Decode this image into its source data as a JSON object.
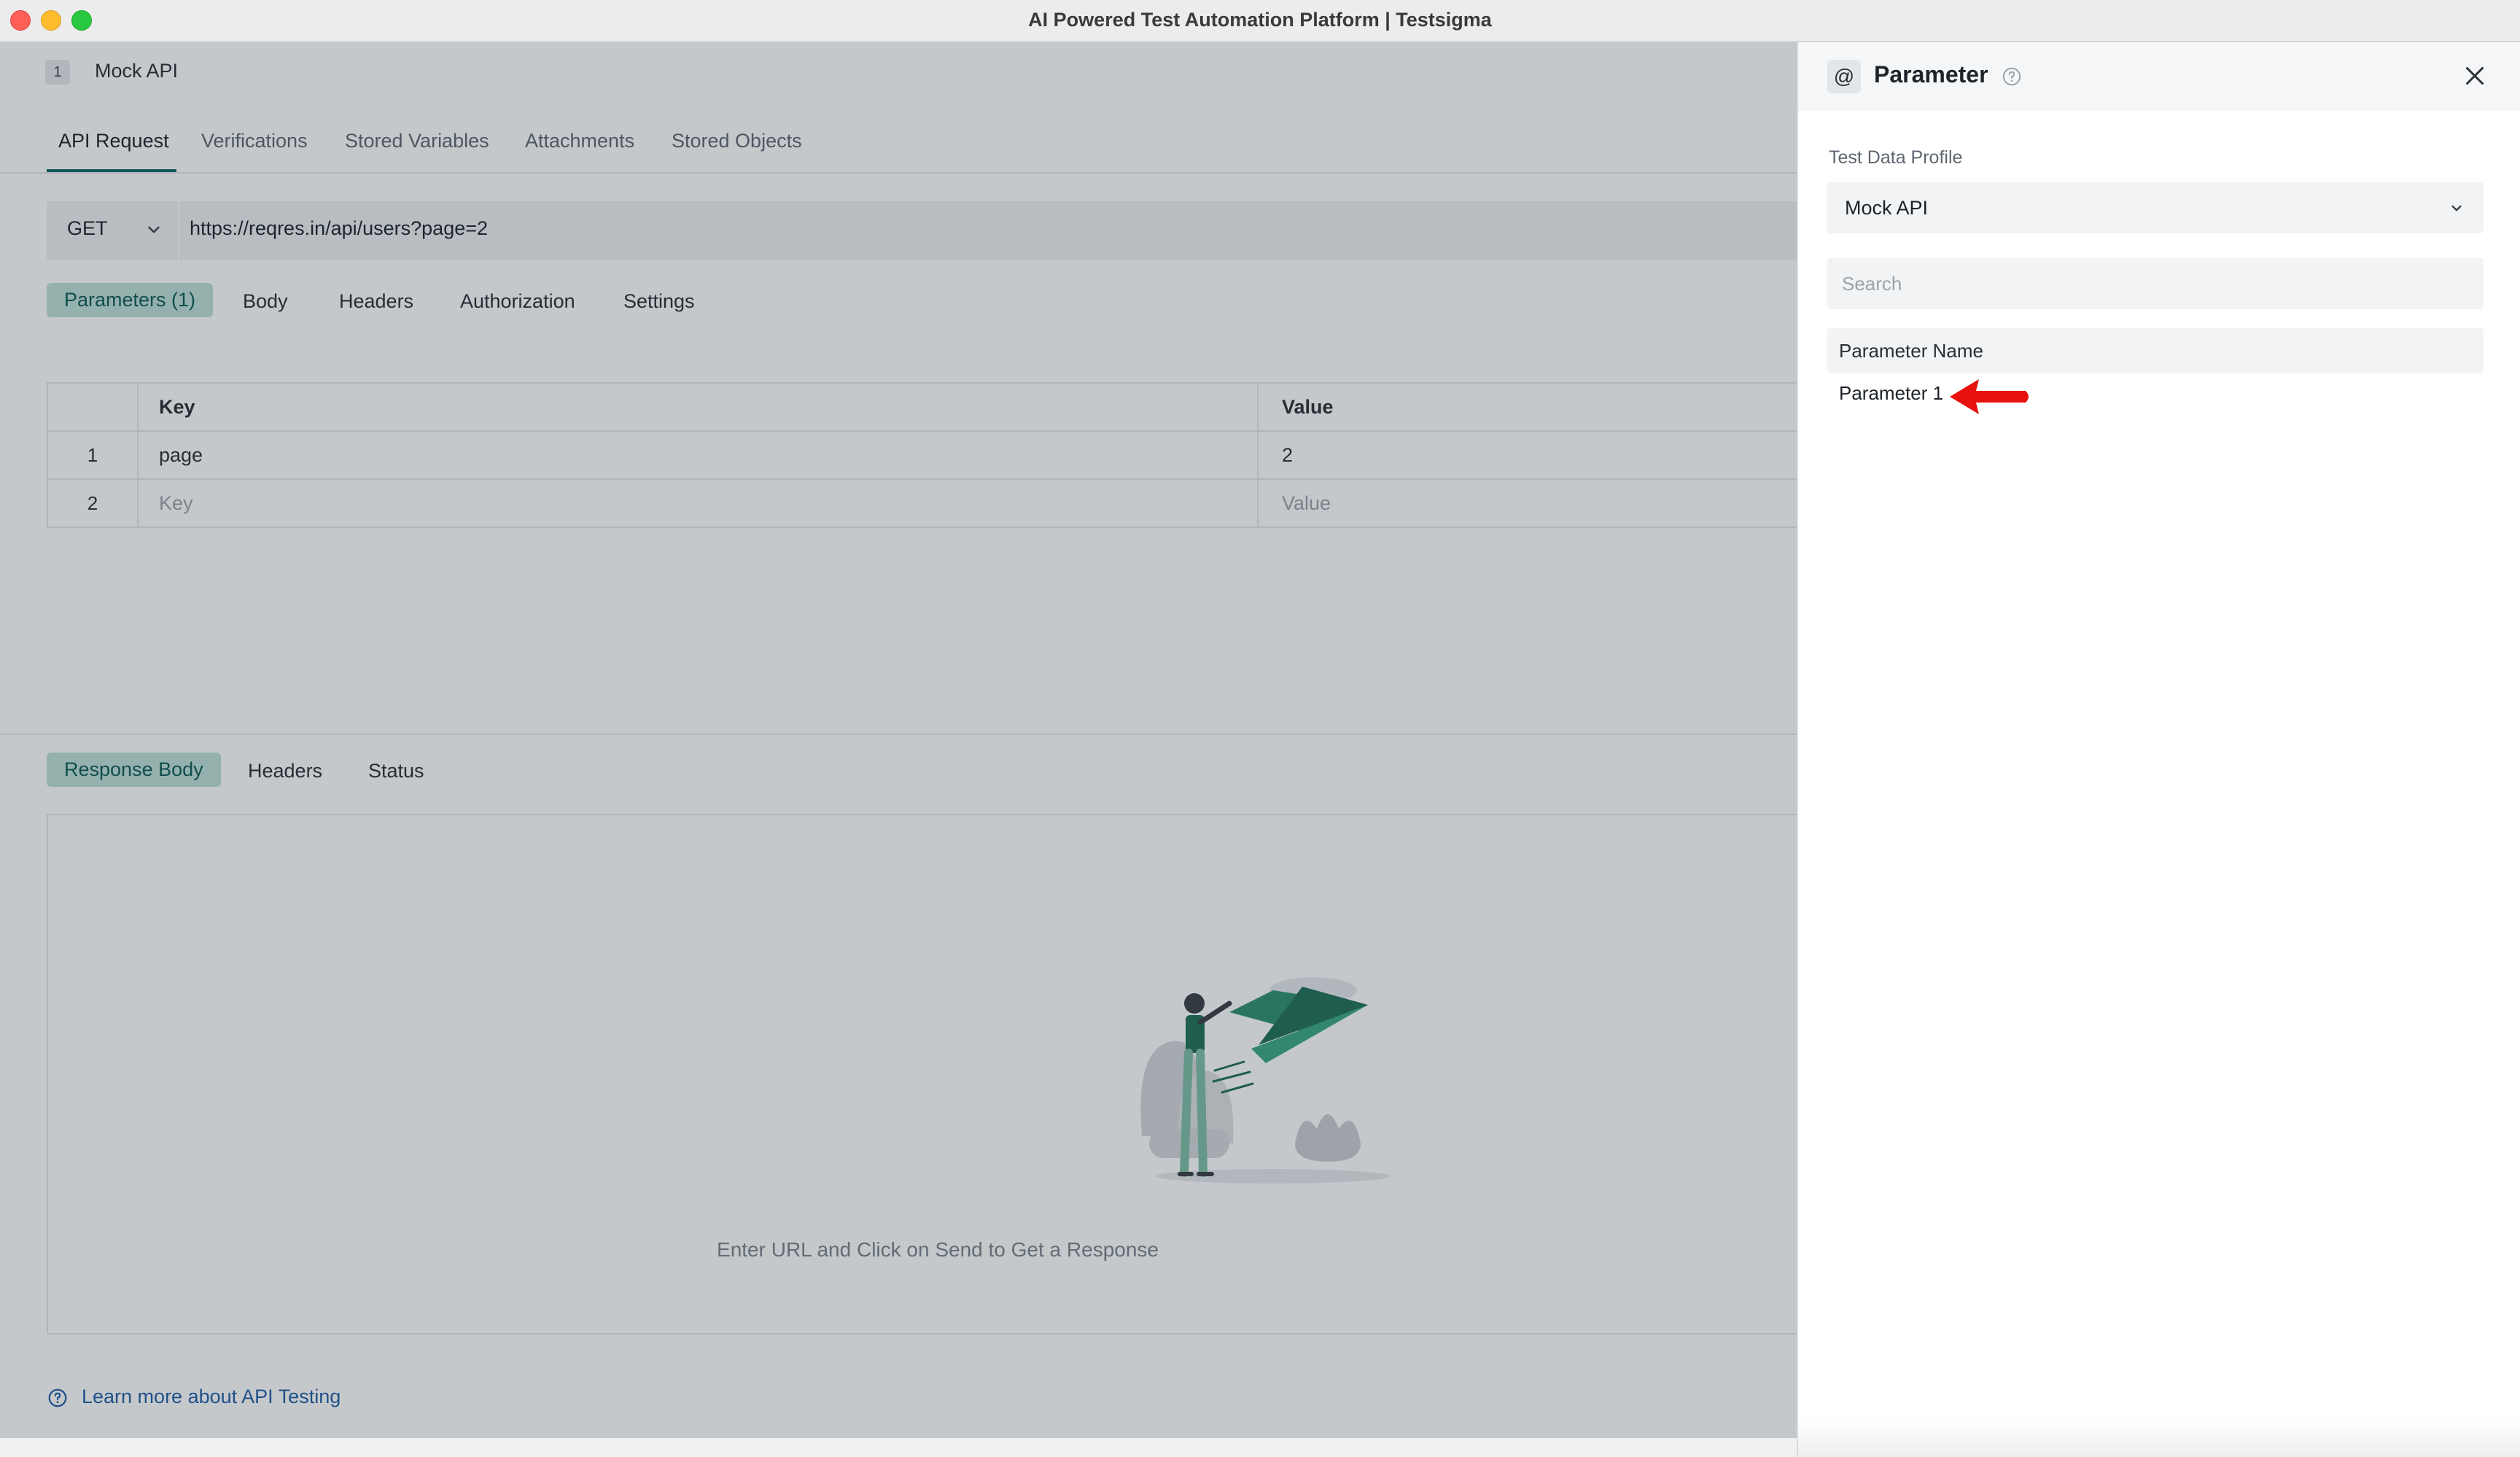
{
  "window": {
    "title": "AI Powered Test Automation Platform | Testsigma"
  },
  "step": {
    "number": "1",
    "name": "Mock API"
  },
  "top_tabs": [
    "API Request",
    "Verifications",
    "Stored Variables",
    "Attachments",
    "Stored Objects"
  ],
  "request": {
    "method": "GET",
    "url": "https://reqres.in/api/users?page=2"
  },
  "request_tabs": [
    "Parameters (1)",
    "Body",
    "Headers",
    "Authorization",
    "Settings"
  ],
  "params_table": {
    "headers": {
      "key": "Key",
      "value": "Value"
    },
    "rows": [
      {
        "index": "1",
        "key": "page",
        "value": "2"
      },
      {
        "index": "2",
        "key": "Key",
        "value": "Value"
      }
    ]
  },
  "response_tabs": [
    "Response Body",
    "Headers",
    "Status"
  ],
  "response": {
    "empty_message": "Enter URL and Click on Send to Get a Response"
  },
  "learn_more": "Learn more about API Testing",
  "panel": {
    "title": "Parameter",
    "at_symbol": "@",
    "test_data_profile_label": "Test Data Profile",
    "test_data_profile_value": "Mock API",
    "search_placeholder": "Search",
    "parameter_name_header": "Parameter Name",
    "parameters": [
      "Parameter 1"
    ]
  },
  "colors": {
    "accent": "#0d6a64",
    "pill_bg": "#bde0d8",
    "link": "#1f5fa8",
    "annotation_arrow": "#e8110d"
  }
}
